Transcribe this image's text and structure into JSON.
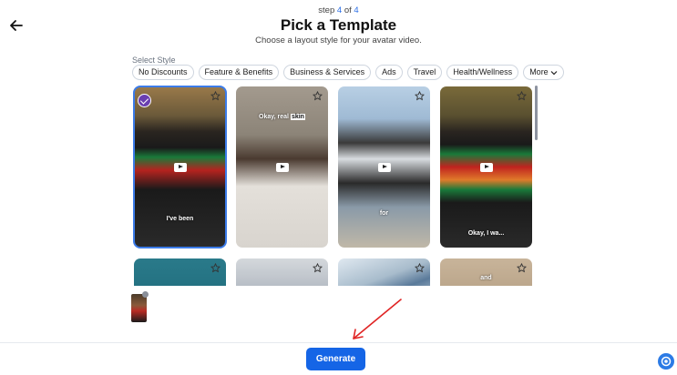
{
  "step": {
    "prefix": "step",
    "current": "4",
    "of": "of",
    "total": "4"
  },
  "title": "Pick a Template",
  "subtitle": "Choose a layout style for your avatar video.",
  "select_label": "Select Style",
  "chips": [
    "No Discounts",
    "Feature & Benefits",
    "Business & Services",
    "Ads",
    "Travel",
    "Health/Wellness"
  ],
  "more_label": "More",
  "cards": [
    {
      "caption": "I've been"
    },
    {
      "caption_pre": "Okay, real",
      "caption_hl": "skin"
    },
    {
      "caption": "for"
    },
    {
      "caption": "Okay, I wa..."
    },
    {
      "caption": ""
    },
    {
      "caption": ""
    },
    {
      "caption": ""
    },
    {
      "caption": "and"
    }
  ],
  "generate_label": "Generate",
  "colors": {
    "primary": "#1565e6",
    "selected_outline": "#3b7be9",
    "check": "#6a3fb0",
    "arrow": "#e02424"
  }
}
